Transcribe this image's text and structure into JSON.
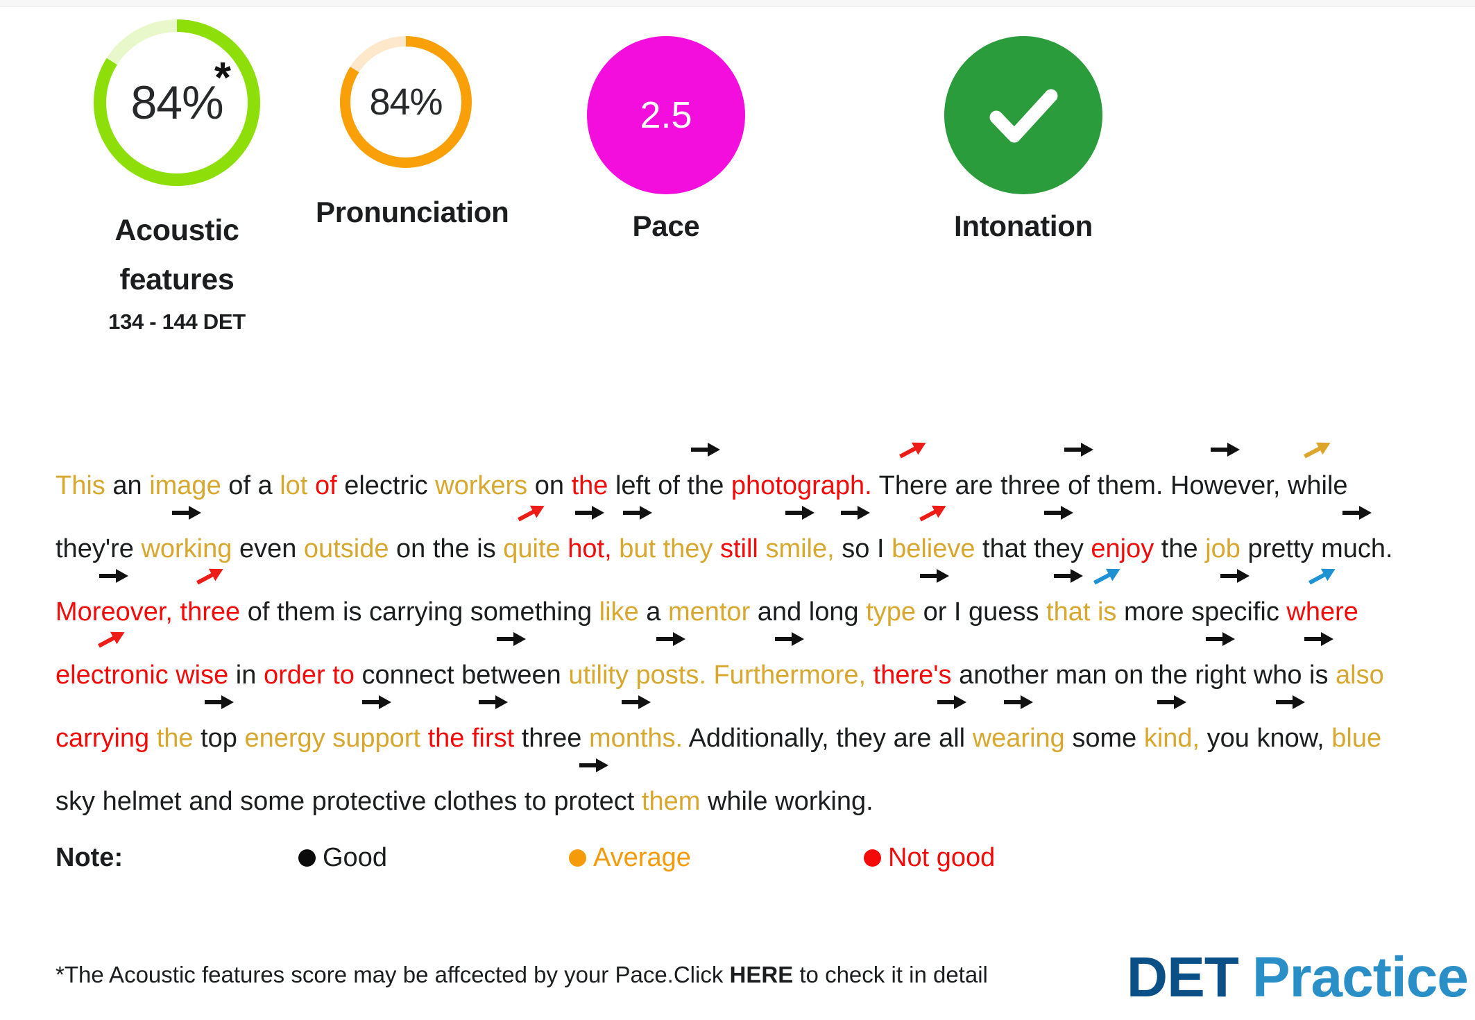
{
  "gauges": [
    {
      "name": "acoustic-features",
      "value_label": "84%",
      "value": 84,
      "label": "Acoustic\nfeatures",
      "label_line1": "Acoustic",
      "label_line2": "features",
      "sublabel": "134 - 144 DET",
      "color": "#8ede09",
      "track_color": "#e8f8cb",
      "type": "ring",
      "asterisk": "*"
    },
    {
      "name": "pronunciation",
      "value_label": "84%",
      "value": 84,
      "label": "Pronunciation",
      "color": "#f9a008",
      "track_color": "#fde8cc",
      "type": "ring"
    },
    {
      "name": "pace",
      "value_label": "2.5",
      "label": "Pace",
      "color": "#f40ede",
      "type": "solid"
    },
    {
      "name": "intonation",
      "value_label": "check-icon",
      "label": "Intonation",
      "color": "#2a9c3c",
      "type": "solid-check"
    }
  ],
  "transcript": {
    "lines": [
      [
        {
          "t": "This",
          "c": "avg",
          "a": ""
        },
        {
          "t": "an",
          "c": "good",
          "a": ""
        },
        {
          "t": "image",
          "c": "avg",
          "a": ""
        },
        {
          "t": "of",
          "c": "good",
          "a": ""
        },
        {
          "t": "a",
          "c": "good",
          "a": ""
        },
        {
          "t": "lot",
          "c": "avg",
          "a": ""
        },
        {
          "t": "of",
          "c": "bad",
          "a": ""
        },
        {
          "t": "electric",
          "c": "good",
          "a": ""
        },
        {
          "t": "workers",
          "c": "avg",
          "a": ""
        },
        {
          "t": "on",
          "c": "good",
          "a": ""
        },
        {
          "t": "the",
          "c": "bad",
          "a": ""
        },
        {
          "t": "left",
          "c": "good",
          "a": ""
        },
        {
          "t": "of",
          "c": "good",
          "a": ""
        },
        {
          "t": "the",
          "c": "good",
          "a": "flat-black"
        },
        {
          "t": "photograph.",
          "c": "bad",
          "a": ""
        },
        {
          "t": "There",
          "c": "good",
          "a": "up-red"
        },
        {
          "t": "are",
          "c": "good",
          "a": ""
        },
        {
          "t": "three",
          "c": "good",
          "a": ""
        },
        {
          "t": "of",
          "c": "good",
          "a": "flat-black"
        },
        {
          "t": "them.",
          "c": "good",
          "a": ""
        },
        {
          "t": "However,",
          "c": "good",
          "a": "flat-black"
        },
        {
          "t": "while",
          "c": "good",
          "a": "up-gold"
        }
      ],
      [
        {
          "t": "they're",
          "c": "good",
          "a": ""
        },
        {
          "t": "working",
          "c": "avg",
          "a": "flat-black"
        },
        {
          "t": "even",
          "c": "good",
          "a": ""
        },
        {
          "t": "outside",
          "c": "avg",
          "a": ""
        },
        {
          "t": "on",
          "c": "good",
          "a": ""
        },
        {
          "t": "the",
          "c": "good",
          "a": ""
        },
        {
          "t": "is",
          "c": "good",
          "a": ""
        },
        {
          "t": "quite",
          "c": "avg",
          "a": "up-red"
        },
        {
          "t": "hot,",
          "c": "bad",
          "a": "flat-black"
        },
        {
          "t": "but",
          "c": "avg",
          "a": "flat-black"
        },
        {
          "t": "they",
          "c": "avg",
          "a": ""
        },
        {
          "t": "still",
          "c": "bad",
          "a": ""
        },
        {
          "t": "smile,",
          "c": "avg",
          "a": "flat-black"
        },
        {
          "t": "so",
          "c": "good",
          "a": "flat-black"
        },
        {
          "t": "I",
          "c": "good",
          "a": ""
        },
        {
          "t": "believe",
          "c": "avg",
          "a": "up-red"
        },
        {
          "t": "that",
          "c": "good",
          "a": ""
        },
        {
          "t": "they",
          "c": "good",
          "a": "flat-black"
        },
        {
          "t": "enjoy",
          "c": "bad",
          "a": ""
        },
        {
          "t": "the",
          "c": "good",
          "a": ""
        },
        {
          "t": "job",
          "c": "avg",
          "a": ""
        },
        {
          "t": "pretty",
          "c": "good",
          "a": ""
        },
        {
          "t": "much.",
          "c": "good",
          "a": "flat-black"
        }
      ],
      [
        {
          "t": "Moreover,",
          "c": "bad",
          "a": "flat-black"
        },
        {
          "t": "three",
          "c": "bad",
          "a": "up-red"
        },
        {
          "t": "of",
          "c": "good",
          "a": ""
        },
        {
          "t": "them",
          "c": "good",
          "a": ""
        },
        {
          "t": "is",
          "c": "good",
          "a": ""
        },
        {
          "t": "carrying",
          "c": "good",
          "a": ""
        },
        {
          "t": "something",
          "c": "good",
          "a": ""
        },
        {
          "t": "like",
          "c": "avg",
          "a": ""
        },
        {
          "t": "a",
          "c": "good",
          "a": ""
        },
        {
          "t": "mentor",
          "c": "avg",
          "a": ""
        },
        {
          "t": "and",
          "c": "good",
          "a": ""
        },
        {
          "t": "long",
          "c": "good",
          "a": ""
        },
        {
          "t": "type",
          "c": "avg",
          "a": ""
        },
        {
          "t": "or",
          "c": "good",
          "a": "flat-black"
        },
        {
          "t": "I",
          "c": "good",
          "a": ""
        },
        {
          "t": "guess",
          "c": "good",
          "a": ""
        },
        {
          "t": "that",
          "c": "avg",
          "a": "flat-black"
        },
        {
          "t": "is",
          "c": "avg",
          "a": "up-blue"
        },
        {
          "t": "more",
          "c": "good",
          "a": ""
        },
        {
          "t": "specific",
          "c": "good",
          "a": "flat-black"
        },
        {
          "t": "where",
          "c": "bad",
          "a": "up-blue"
        }
      ],
      [
        {
          "t": "electronic",
          "c": "bad",
          "a": "up-red"
        },
        {
          "t": "wise",
          "c": "bad",
          "a": ""
        },
        {
          "t": "in",
          "c": "good",
          "a": ""
        },
        {
          "t": "order",
          "c": "bad",
          "a": ""
        },
        {
          "t": "to",
          "c": "bad",
          "a": ""
        },
        {
          "t": "connect",
          "c": "good",
          "a": ""
        },
        {
          "t": "between",
          "c": "good",
          "a": "flat-black"
        },
        {
          "t": "utility",
          "c": "avg",
          "a": ""
        },
        {
          "t": "posts.",
          "c": "avg",
          "a": "flat-black"
        },
        {
          "t": "Furthermore,",
          "c": "avg",
          "a": "flat-black"
        },
        {
          "t": "there's",
          "c": "bad",
          "a": ""
        },
        {
          "t": "another",
          "c": "good",
          "a": ""
        },
        {
          "t": "man",
          "c": "good",
          "a": ""
        },
        {
          "t": "on",
          "c": "good",
          "a": ""
        },
        {
          "t": "the",
          "c": "good",
          "a": ""
        },
        {
          "t": "right",
          "c": "good",
          "a": "flat-black"
        },
        {
          "t": "who",
          "c": "good",
          "a": ""
        },
        {
          "t": "is",
          "c": "good",
          "a": "flat-black"
        },
        {
          "t": "also",
          "c": "avg",
          "a": ""
        }
      ],
      [
        {
          "t": "carrying",
          "c": "bad",
          "a": ""
        },
        {
          "t": "the",
          "c": "avg",
          "a": ""
        },
        {
          "t": "top",
          "c": "good",
          "a": "flat-black"
        },
        {
          "t": "energy",
          "c": "avg",
          "a": ""
        },
        {
          "t": "support",
          "c": "avg",
          "a": "flat-black"
        },
        {
          "t": "the",
          "c": "bad",
          "a": ""
        },
        {
          "t": "first",
          "c": "bad",
          "a": "flat-black"
        },
        {
          "t": "three",
          "c": "good",
          "a": ""
        },
        {
          "t": "months.",
          "c": "avg",
          "a": "flat-black"
        },
        {
          "t": "Additionally,",
          "c": "good",
          "a": ""
        },
        {
          "t": "they",
          "c": "good",
          "a": ""
        },
        {
          "t": "are",
          "c": "good",
          "a": ""
        },
        {
          "t": "all",
          "c": "good",
          "a": "flat-black"
        },
        {
          "t": "wearing",
          "c": "avg",
          "a": "flat-black"
        },
        {
          "t": "some",
          "c": "good",
          "a": ""
        },
        {
          "t": "kind,",
          "c": "avg",
          "a": "flat-black"
        },
        {
          "t": "you",
          "c": "good",
          "a": ""
        },
        {
          "t": "know,",
          "c": "good",
          "a": "flat-black"
        },
        {
          "t": "blue",
          "c": "avg",
          "a": ""
        }
      ],
      [
        {
          "t": "sky",
          "c": "good",
          "a": ""
        },
        {
          "t": "helmet",
          "c": "good",
          "a": ""
        },
        {
          "t": "and",
          "c": "good",
          "a": ""
        },
        {
          "t": "some",
          "c": "good",
          "a": ""
        },
        {
          "t": "protective",
          "c": "good",
          "a": ""
        },
        {
          "t": "clothes",
          "c": "good",
          "a": ""
        },
        {
          "t": "to",
          "c": "good",
          "a": ""
        },
        {
          "t": "protect",
          "c": "good",
          "a": "flat-black"
        },
        {
          "t": "them",
          "c": "avg",
          "a": ""
        },
        {
          "t": "while",
          "c": "good",
          "a": ""
        },
        {
          "t": "working.",
          "c": "good",
          "a": ""
        }
      ]
    ]
  },
  "note": {
    "label": "Note:",
    "legend": [
      {
        "text": "Good",
        "color": "#0b0b0b"
      },
      {
        "text": "Average",
        "color": "#f59a09"
      },
      {
        "text": "Not good",
        "color": "#f50a0a"
      }
    ]
  },
  "footer": {
    "text_before": "*The Acoustic features score may be affcected by your Pace.Click ",
    "link": "HERE",
    "text_after": " to check it in detail",
    "logo_det": "DET",
    "logo_practice": "Practice"
  },
  "colors": {
    "good": "#1b1d1f",
    "average": "#d8a72e",
    "not_good": "#f50a0a",
    "arrow_black": "#111111",
    "arrow_red": "#ee1c17",
    "arrow_gold": "#dca52c",
    "arrow_blue": "#1e92d2"
  }
}
